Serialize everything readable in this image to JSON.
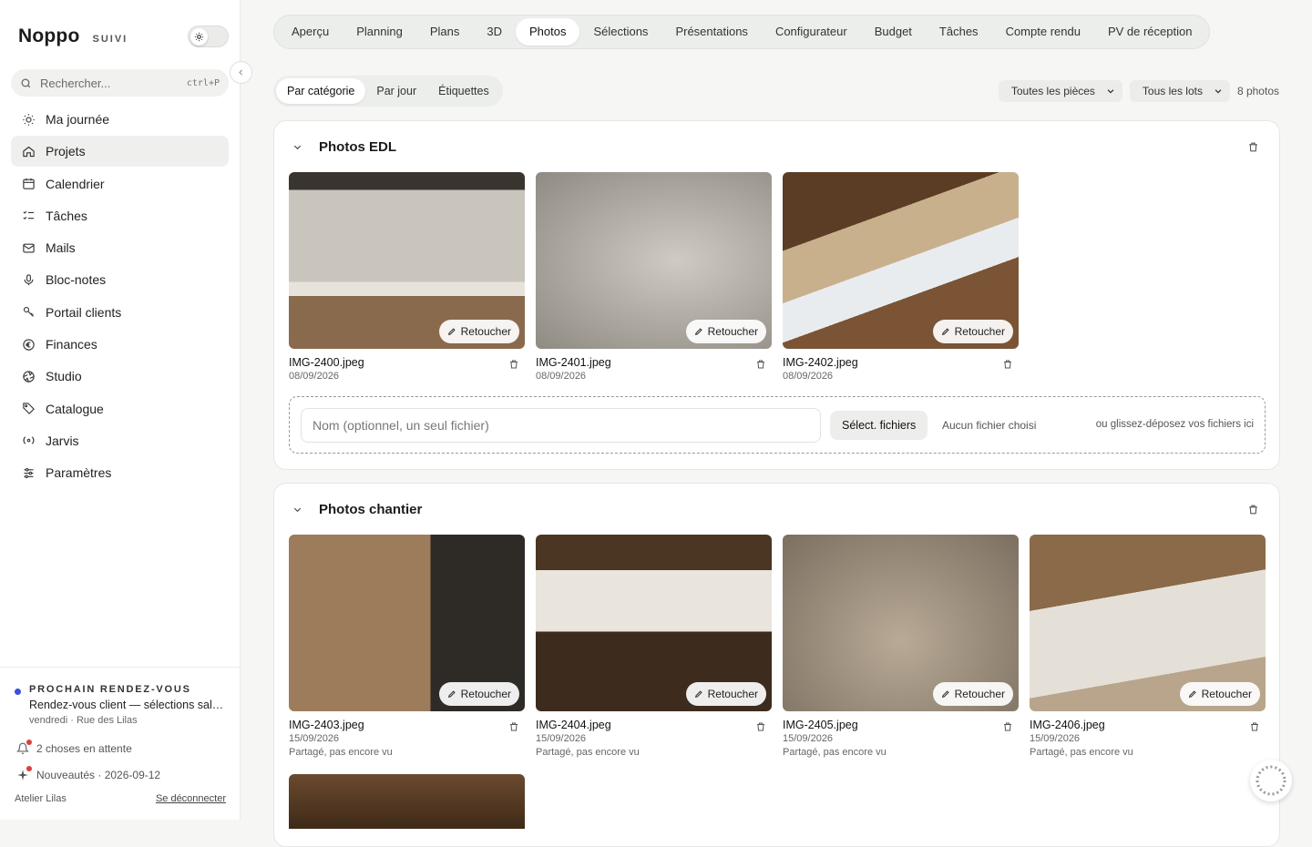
{
  "brand": {
    "name": "Noppo",
    "sub": "SUIVI"
  },
  "search": {
    "placeholder": "Rechercher...",
    "shortcut": "ctrl+P"
  },
  "nav": [
    {
      "label": "Ma journée",
      "icon": "sun-icon",
      "active": false
    },
    {
      "label": "Projets",
      "icon": "home-icon",
      "active": true
    },
    {
      "label": "Calendrier",
      "icon": "calendar-icon",
      "active": false
    },
    {
      "label": "Tâches",
      "icon": "checklist-icon",
      "active": false
    },
    {
      "label": "Mails",
      "icon": "mail-icon",
      "active": false
    },
    {
      "label": "Bloc-notes",
      "icon": "microphone-icon",
      "active": false
    },
    {
      "label": "Portail clients",
      "icon": "key-icon",
      "active": false
    },
    {
      "label": "Finances",
      "icon": "euro-icon",
      "active": false
    },
    {
      "label": "Studio",
      "icon": "aperture-icon",
      "active": false
    },
    {
      "label": "Catalogue",
      "icon": "tag-icon",
      "active": false
    },
    {
      "label": "Jarvis",
      "icon": "radar-icon",
      "active": false
    },
    {
      "label": "Paramètres",
      "icon": "sliders-icon",
      "active": false
    }
  ],
  "rdv": {
    "label": "PROCHAIN RENDEZ-VOUS",
    "title": "Rendez-vous client — sélections salle de bain",
    "meta": "vendredi · Rue des Lilas"
  },
  "pending": "2 choses en attente",
  "news": "Nouveautés · 2026-09-12",
  "footer": {
    "org": "Atelier Lilas",
    "logout": "Se déconnecter"
  },
  "tabs": [
    "Aperçu",
    "Planning",
    "Plans",
    "3D",
    "Photos",
    "Sélections",
    "Présentations",
    "Configurateur",
    "Budget",
    "Tâches",
    "Compte rendu",
    "PV de réception"
  ],
  "active_tab": "Photos",
  "subtabs": [
    "Par catégorie",
    "Par jour",
    "Étiquettes"
  ],
  "filters": {
    "rooms": "Toutes les pièces",
    "lots": "Tous les lots",
    "count": "8 photos"
  },
  "retouch_label": "Retoucher",
  "sections": [
    {
      "title": "Photos EDL",
      "photos": [
        {
          "name": "IMG-2400.jpeg",
          "date": "08/09/2026",
          "share": ""
        },
        {
          "name": "IMG-2401.jpeg",
          "date": "08/09/2026",
          "share": ""
        },
        {
          "name": "IMG-2402.jpeg",
          "date": "08/09/2026",
          "share": ""
        }
      ]
    },
    {
      "title": "Photos chantier",
      "photos": [
        {
          "name": "IMG-2403.jpeg",
          "date": "15/09/2026",
          "share": "Partagé, pas encore vu"
        },
        {
          "name": "IMG-2404.jpeg",
          "date": "15/09/2026",
          "share": "Partagé, pas encore vu"
        },
        {
          "name": "IMG-2405.jpeg",
          "date": "15/09/2026",
          "share": "Partagé, pas encore vu"
        },
        {
          "name": "IMG-2406.jpeg",
          "date": "15/09/2026",
          "share": "Partagé, pas encore vu"
        }
      ]
    }
  ],
  "upload": {
    "placeholder": "Nom (optionnel, un seul fichier)",
    "select": "Sélect. fichiers",
    "none": "Aucun fichier choisi",
    "dragdrop": "ou glissez-déposez vos fichiers ici"
  },
  "colors": {
    "accent_dot": "#3b4fd8",
    "badge": "#d9413a",
    "active_bg": "#efefed"
  }
}
